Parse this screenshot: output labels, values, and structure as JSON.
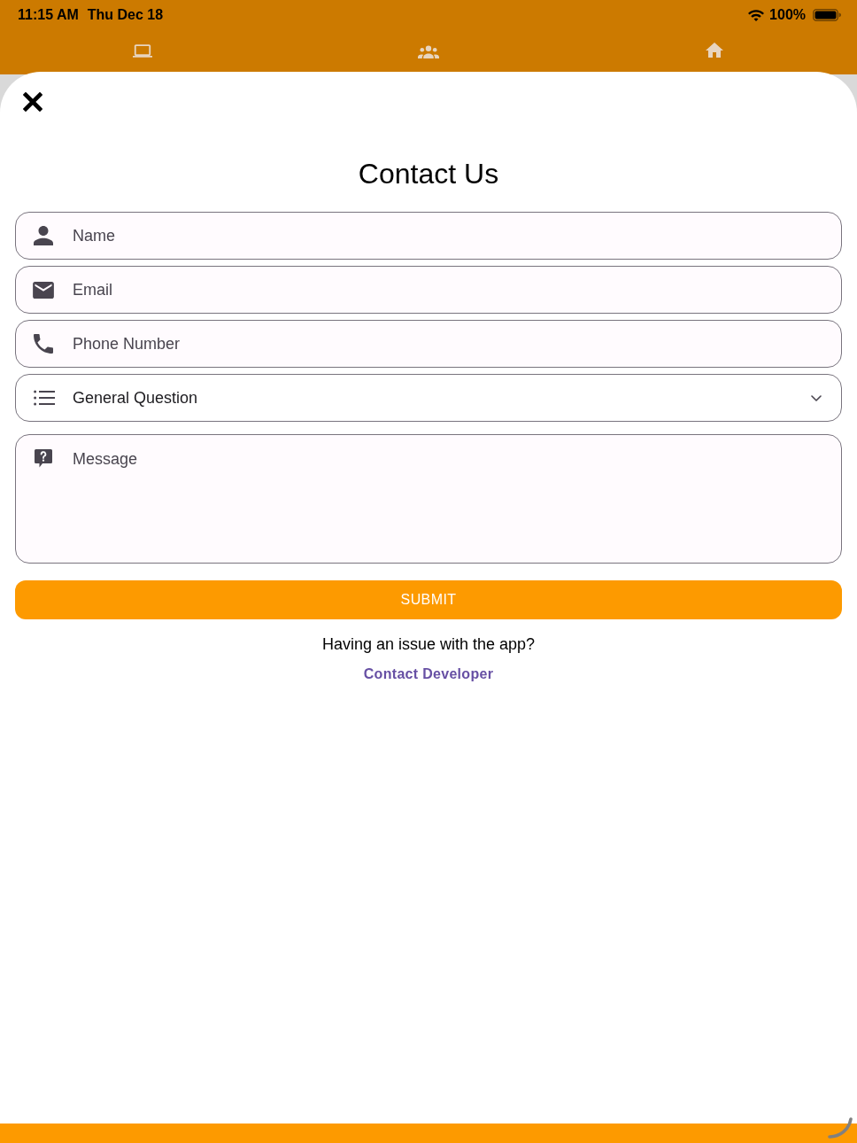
{
  "status_bar": {
    "time": "11:15 AM",
    "date": "Thu Dec 18",
    "battery": "100%"
  },
  "contact_form": {
    "title": "Contact Us",
    "fields": [
      {
        "kind": "text",
        "placeholder": "Name"
      },
      {
        "kind": "text",
        "placeholder": "Email"
      },
      {
        "kind": "text",
        "placeholder": "Phone Number"
      },
      {
        "kind": "dropdown",
        "value": "General Question"
      },
      {
        "kind": "textarea",
        "placeholder": "Message"
      }
    ],
    "submit_button": "SUBMIT",
    "help_text": "Having an issue with the app?",
    "help_link": "Contact Developer"
  }
}
